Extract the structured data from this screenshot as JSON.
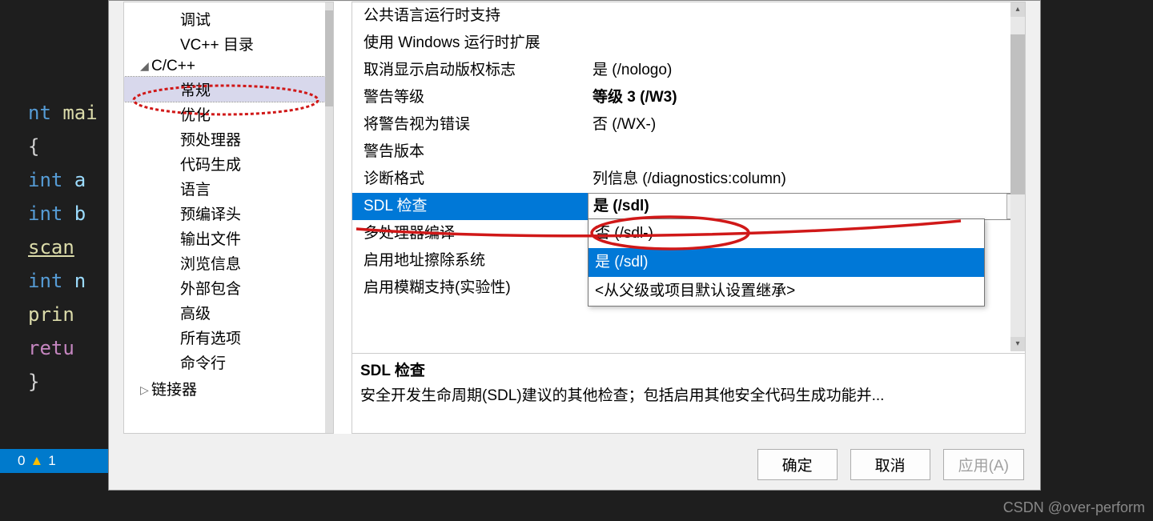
{
  "editor": {
    "l1_kw": "nt ",
    "l1_fn": "mai",
    "l3_kw": "int ",
    "l3_id": "a",
    "l4_kw": "int ",
    "l4_id": "b",
    "l5_fn": "scan",
    "l6_kw": "int ",
    "l6_id": "n",
    "l7_fn": "prin",
    "l8_ctrl": "retu"
  },
  "tree": {
    "items": [
      {
        "label": "调试",
        "level": 2
      },
      {
        "label": "VC++ 目录",
        "level": 2
      },
      {
        "label": "C/C++",
        "level": 1,
        "expanded": true
      },
      {
        "label": "常规",
        "level": 2,
        "selected": true
      },
      {
        "label": "优化",
        "level": 2
      },
      {
        "label": "预处理器",
        "level": 2
      },
      {
        "label": "代码生成",
        "level": 2
      },
      {
        "label": "语言",
        "level": 2
      },
      {
        "label": "预编译头",
        "level": 2
      },
      {
        "label": "输出文件",
        "level": 2
      },
      {
        "label": "浏览信息",
        "level": 2
      },
      {
        "label": "外部包含",
        "level": 2
      },
      {
        "label": "高级",
        "level": 2
      },
      {
        "label": "所有选项",
        "level": 2
      },
      {
        "label": "命令行",
        "level": 2
      },
      {
        "label": "链接器",
        "level": 1,
        "cut": true
      }
    ]
  },
  "props": {
    "rows": [
      {
        "label": "公共语言运行时支持",
        "value": ""
      },
      {
        "label": "使用 Windows 运行时扩展",
        "value": ""
      },
      {
        "label": "取消显示启动版权标志",
        "value": "是 (/nologo)"
      },
      {
        "label": "警告等级",
        "value": "等级 3 (/W3)",
        "bold": true
      },
      {
        "label": "将警告视为错误",
        "value": "否 (/WX-)"
      },
      {
        "label": "警告版本",
        "value": ""
      },
      {
        "label": "诊断格式",
        "value": "列信息 (/diagnostics:column)"
      },
      {
        "label": "SDL 检查",
        "value": "是 (/sdl)",
        "selected": true
      },
      {
        "label": "多处理器编译",
        "value": ""
      },
      {
        "label": "启用地址擦除系统",
        "value": ""
      },
      {
        "label": "启用模糊支持(实验性)",
        "value": ""
      }
    ]
  },
  "dropdown": {
    "items": [
      {
        "label": "否 (/sdl-)"
      },
      {
        "label": "是 (/sdl)",
        "hover": true
      },
      {
        "label": "<从父级或项目默认设置继承>"
      }
    ]
  },
  "help": {
    "title": "SDL 检查",
    "text": "安全开发生命周期(SDL)建议的其他检查；包括启用其他安全代码生成功能并..."
  },
  "buttons": {
    "ok": "确定",
    "cancel": "取消",
    "apply": "应用(A)"
  },
  "status": {
    "count": "0",
    "warn": "1"
  },
  "watermark": "CSDN @over-perform"
}
